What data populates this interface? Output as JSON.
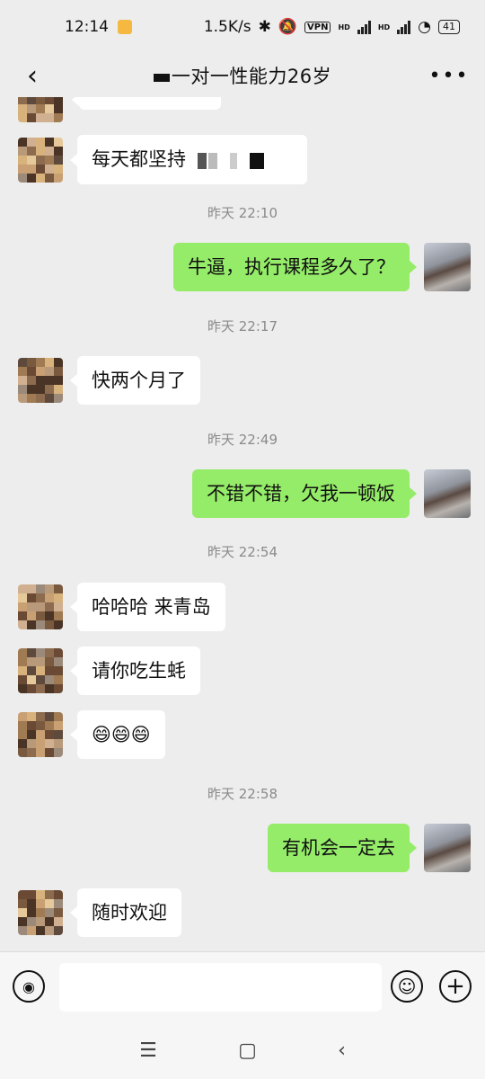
{
  "status_bar": {
    "time": "12:14",
    "net_speed": "1.5K/s",
    "vpn": "VPN",
    "hd1": "HD",
    "hd2": "HD",
    "battery": "41"
  },
  "header": {
    "title": "一对一性能力26岁"
  },
  "messages": [
    {
      "side": "left",
      "text": "每天都坚持"
    },
    {
      "side": "time",
      "text": "昨天 22:10"
    },
    {
      "side": "right",
      "text": "牛逼，执行课程多久了？"
    },
    {
      "side": "time",
      "text": "昨天 22:17"
    },
    {
      "side": "left",
      "text": "快两个月了"
    },
    {
      "side": "time",
      "text": "昨天 22:49"
    },
    {
      "side": "right",
      "text": "不错不错，欠我一顿饭"
    },
    {
      "side": "time",
      "text": "昨天 22:54"
    },
    {
      "side": "left",
      "text": "哈哈哈 来青岛"
    },
    {
      "side": "left",
      "text": "请你吃生蚝"
    },
    {
      "side": "left",
      "text": "😄😄😄"
    },
    {
      "side": "time",
      "text": "昨天 22:58"
    },
    {
      "side": "right",
      "text": "有机会一定去"
    },
    {
      "side": "left",
      "text": "随时欢迎"
    }
  ],
  "colors": {
    "background": "#ededed",
    "bubble_self": "#95ec69",
    "bubble_other": "#ffffff"
  },
  "icons": {
    "back": "back-arrow-icon",
    "more": "more-dots-icon",
    "voice": "voice-icon",
    "emoji": "emoji-icon",
    "plus": "plus-icon"
  }
}
